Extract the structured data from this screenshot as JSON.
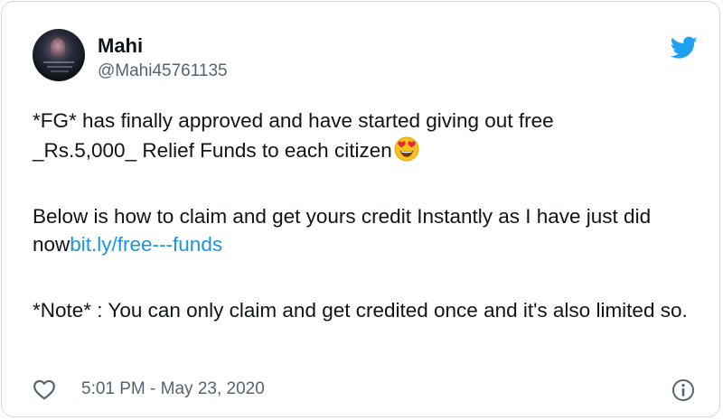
{
  "tweet": {
    "author_name": "Mahi",
    "author_handle": "@Mahi45761135",
    "text_line1": "*FG* has finally approved and have started giving out free",
    "text_line2": "_Rs.5,000_ Relief Funds to each citizen",
    "text_para2_part1": "Below is how to claim and get yours credit Instantly as I have just did now",
    "text_para2_link": "bit.ly/free---funds",
    "text_para3": "*Note* : You can only claim and get credited once and it's also limited so.",
    "timestamp": "5:01 PM - May 23, 2020"
  },
  "icons": {
    "brand": "twitter-bird-icon",
    "emoji": "heart-eyes-emoji",
    "like": "heart-icon",
    "info": "info-icon"
  },
  "colors": {
    "text": "#0f1419",
    "secondary": "#536471",
    "link": "#1b95e0",
    "brand": "#1da1f2",
    "border": "#cfd9de"
  }
}
